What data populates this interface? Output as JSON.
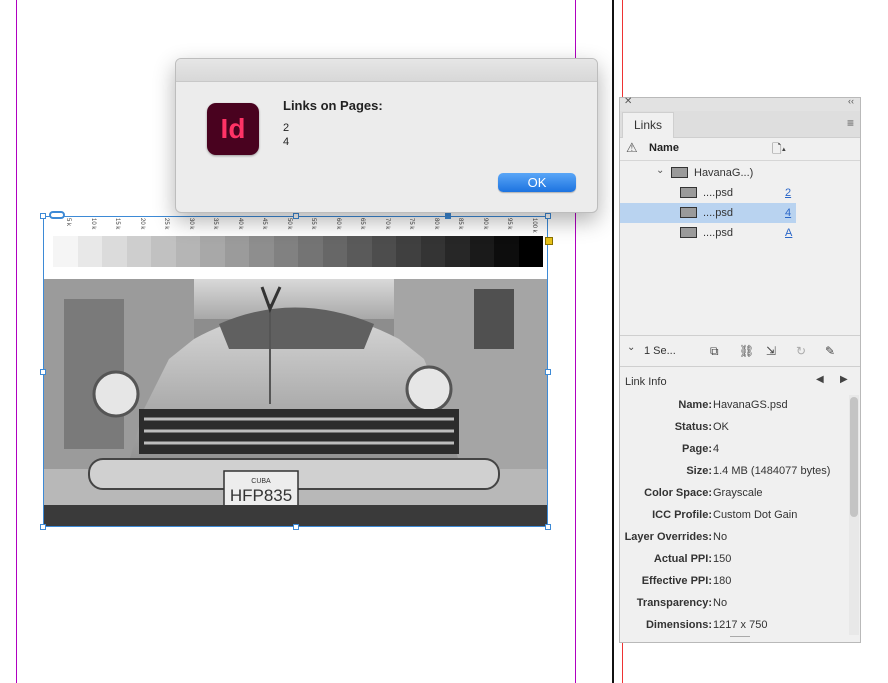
{
  "dialog": {
    "app_icon_text": "Id",
    "title": "Links on Pages:",
    "lines": [
      "2",
      "4"
    ],
    "ok_label": "OK"
  },
  "image_ruler": {
    "tick_labels": [
      "5 k",
      "10 k",
      "15 k",
      "20 k",
      "25 k",
      "30 k",
      "35 k",
      "40 k",
      "45 k",
      "50 k",
      "55 k",
      "60 k",
      "65 k",
      "70 k",
      "75 k",
      "80 k",
      "85 k",
      "90 k",
      "95 k",
      "100 k"
    ]
  },
  "links_panel": {
    "tab_label": "Links",
    "columns": {
      "name": "Name"
    },
    "parent_item": "HavanaG...)",
    "rows": [
      {
        "name": "....psd",
        "page": "2",
        "selected": false
      },
      {
        "name": "....psd",
        "page": "4",
        "selected": true
      },
      {
        "name": "....psd",
        "page": "A",
        "selected": false
      }
    ],
    "selection_summary": "1 Se...",
    "info_title": "Link Info",
    "info": [
      {
        "key": "Name:",
        "value": "HavanaGS.psd"
      },
      {
        "key": "Status:",
        "value": "OK"
      },
      {
        "key": "Page:",
        "value": "4"
      },
      {
        "key": "Size:",
        "value": "1.4 MB (1484077 bytes)"
      },
      {
        "key": "Color Space:",
        "value": "Grayscale"
      },
      {
        "key": "ICC Profile:",
        "value": "Custom Dot Gain"
      },
      {
        "key": "Layer Overrides:",
        "value": "No"
      },
      {
        "key": "Actual PPI:",
        "value": "150"
      },
      {
        "key": "Effective PPI:",
        "value": "180"
      },
      {
        "key": "Transparency:",
        "value": "No"
      },
      {
        "key": "Dimensions:",
        "value": "1217 x 750"
      }
    ]
  },
  "colors": {
    "accent": "#3d8ad6",
    "guide": "#b000c0",
    "ok_button": "#1c73e0",
    "selection": "#b9d3f0"
  }
}
